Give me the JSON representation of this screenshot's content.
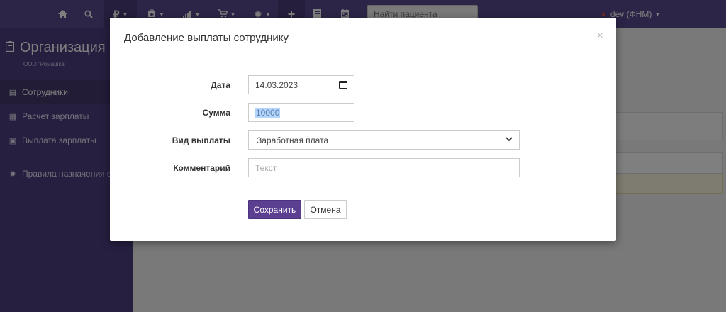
{
  "navbar": {
    "icons": [
      "home-icon",
      "search-icon",
      "ruble-icon",
      "medkit-icon",
      "signal-icon",
      "cart-icon",
      "gear-icon",
      "plus-icon",
      "list-icon",
      "calendar-icon"
    ],
    "search_placeholder": "Найти пациента",
    "user_label": "dev  (ФНМ)"
  },
  "sidebar": {
    "title": "Организация",
    "subtitle": "ООО \"Ромашка\"",
    "items": [
      {
        "label": "Сотрудники",
        "icon": "id-card-icon"
      },
      {
        "label": "Расчет зарплаты",
        "icon": "table-icon"
      },
      {
        "label": "Выплата зарплаты",
        "icon": "money-icon"
      },
      {
        "label": "Правила назначения ставок",
        "icon": "gear-icon"
      }
    ]
  },
  "modal": {
    "title": "Добавление выплаты сотруднику",
    "close": "×",
    "fields": {
      "date_label": "Дата",
      "date_value": "14.03.2023",
      "sum_label": "Сумма",
      "sum_value": "10000",
      "kind_label": "Вид выплаты",
      "kind_value": "Заработная плата",
      "comment_label": "Комментарий",
      "comment_placeholder": "Текст"
    },
    "save_label": "Сохранить",
    "cancel_label": "Отмена"
  },
  "colors": {
    "navbar": "#5b4a8e",
    "sidebar": "#4d3f80",
    "primary_button": "#5b3f91"
  }
}
